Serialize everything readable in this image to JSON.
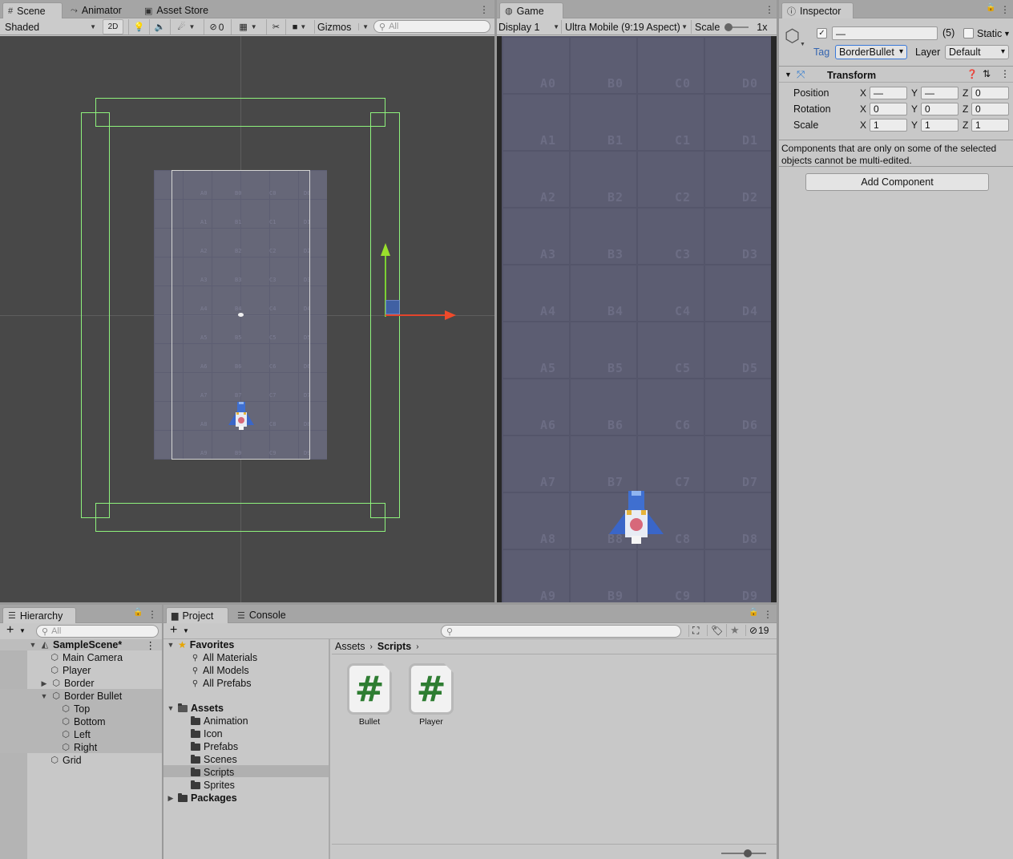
{
  "scene": {
    "tabs": [
      {
        "label": "Scene",
        "icon": "grid-icon"
      },
      {
        "label": "Animator",
        "icon": "animator-icon"
      },
      {
        "label": "Asset Store",
        "icon": "store-icon"
      }
    ],
    "toolbar": {
      "shading": "Shaded",
      "mode_2d": "2D",
      "hidden_count": "0",
      "gizmos": "Gizmos",
      "search_placeholder": "All"
    },
    "grid_labels": [
      "A0",
      "B0",
      "C0",
      "D0",
      "A1",
      "B1",
      "C1",
      "D1",
      "A2",
      "B2",
      "C2",
      "D2",
      "A3",
      "B3",
      "C3",
      "D3",
      "A4",
      "B4",
      "C4",
      "D4",
      "A5",
      "B5",
      "C5",
      "D5",
      "A6",
      "B6",
      "C6",
      "D6",
      "A7",
      "B7",
      "C7",
      "D7",
      "A8",
      "B8",
      "C8",
      "D8",
      "A9",
      "B9",
      "C9",
      "D9"
    ]
  },
  "game": {
    "tab": {
      "label": "Game",
      "icon": "gamepad-icon"
    },
    "toolbar": {
      "display": "Display 1",
      "aspect": "Ultra Mobile (9:19 Aspect)",
      "scale_label": "Scale",
      "scale_value": "1x"
    },
    "grid_labels": [
      "A0",
      "B0",
      "C0",
      "D0",
      "A1",
      "B1",
      "C1",
      "D1",
      "A2",
      "B2",
      "C2",
      "D2",
      "A3",
      "B3",
      "C3",
      "D3",
      "A4",
      "B4",
      "C4",
      "D4",
      "A5",
      "B5",
      "C5",
      "D5",
      "A6",
      "B6",
      "C6",
      "D6",
      "A7",
      "B7",
      "C7",
      "D7",
      "A8",
      "B8",
      "C8",
      "D8",
      "A9",
      "B9",
      "C9",
      "D9"
    ]
  },
  "inspector": {
    "tab": "Inspector",
    "object_name": "—",
    "selected_count": "(5)",
    "static_label": "Static",
    "tag_label": "Tag",
    "tag_value": "BorderBullet",
    "layer_label": "Layer",
    "layer_value": "Default",
    "transform": {
      "title": "Transform",
      "rows": [
        {
          "label": "Position",
          "x": "—",
          "y": "—",
          "z": "0"
        },
        {
          "label": "Rotation",
          "x": "0",
          "y": "0",
          "z": "0"
        },
        {
          "label": "Scale",
          "x": "1",
          "y": "1",
          "z": "1"
        }
      ],
      "axis_x": "X",
      "axis_y": "Y",
      "axis_z": "Z"
    },
    "multi_edit_note": "Components that are only on some of the selected objects cannot be multi-edited.",
    "add_component": "Add Component"
  },
  "hierarchy": {
    "tab": "Hierarchy",
    "search_placeholder": "All",
    "scene_name": "SampleScene*",
    "items": [
      "Main Camera",
      "Player",
      "Border",
      "Border Bullet",
      "Top",
      "Bottom",
      "Left",
      "Right",
      "Grid"
    ]
  },
  "project": {
    "tabs": [
      "Project",
      "Console"
    ],
    "hidden_count": "19",
    "favorites": {
      "label": "Favorites",
      "items": [
        "All Materials",
        "All Models",
        "All Prefabs"
      ]
    },
    "assets": {
      "label": "Assets",
      "items": [
        "Animation",
        "Icon",
        "Prefabs",
        "Scenes",
        "Scripts",
        "Sprites"
      ]
    },
    "packages": "Packages",
    "breadcrumb": [
      "Assets",
      "Scripts"
    ],
    "files": [
      {
        "name": "Bullet",
        "icon": "csharp-script-icon"
      },
      {
        "name": "Player",
        "icon": "csharp-script-icon"
      }
    ]
  }
}
